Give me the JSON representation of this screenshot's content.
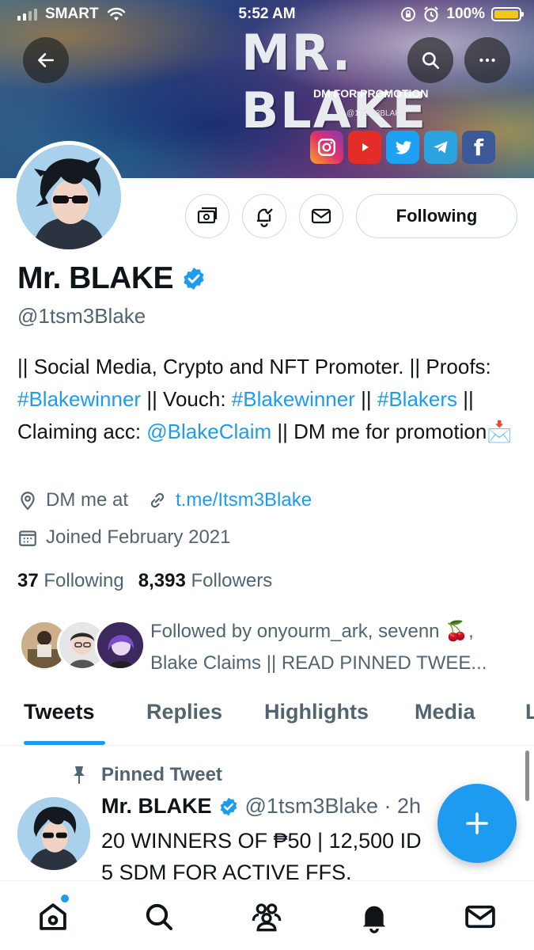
{
  "status_bar": {
    "carrier": "SMART",
    "time": "5:52 AM",
    "battery": "100%"
  },
  "banner": {
    "title": "MR. BLAKE",
    "subtitle": "DM FOR PROMOTION",
    "handle": "@1TSM3BLAKE",
    "social_icons": [
      "instagram-icon",
      "youtube-icon",
      "twitter-icon",
      "telegram-icon",
      "facebook-icon"
    ]
  },
  "profile": {
    "name": "Mr. BLAKE",
    "handle": "@1tsm3Blake",
    "bio": {
      "part1": "|| Social Media, Crypto and NFT Promoter. || Proofs: ",
      "tag1": "#Blakewinner",
      "part2": " || Vouch: ",
      "tag2": "#Blakewinner",
      "part3": " || ",
      "tag3": "#Blakers",
      "part4": " || Claiming acc: ",
      "mention": "@BlakeClaim",
      "part5": " || DM me for promotion",
      "emoji": "📩"
    },
    "location": "DM me at",
    "link": "t.me/Itsm3Blake",
    "joined": "Joined February 2021",
    "following_count": "37",
    "following_label": "Following",
    "followers_count": "8,393",
    "followers_label": "Followers",
    "followed_by": "Followed by onyourm_ark, sevenn 🍒, Blake Claims || READ PINNED TWEE..."
  },
  "actions": {
    "following_button": "Following"
  },
  "tabs": [
    "Tweets",
    "Replies",
    "Highlights",
    "Media",
    "L"
  ],
  "pinned_tweet": {
    "label": "Pinned Tweet",
    "name": "Mr. BLAKE",
    "handle_time": "@1tsm3Blake · 2h",
    "line1": "20 WINNERS OF ₱50 | 12,500 ID",
    "line2": "5 SDM FOR ACTIVE FFS."
  },
  "colors": {
    "accent": "#1d9bf0",
    "text": "#0f1419",
    "secondary": "#536471",
    "border": "#cfd9de"
  }
}
